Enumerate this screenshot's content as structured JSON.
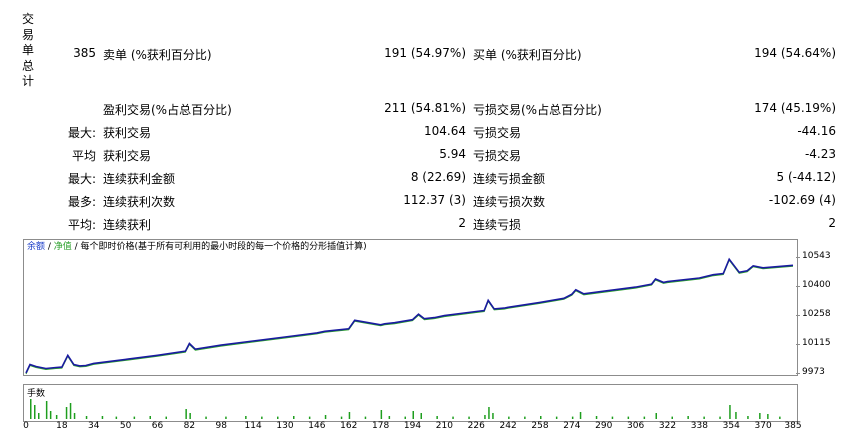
{
  "sidebar": {
    "chars": [
      "交",
      "易",
      "单",
      "总",
      "计"
    ]
  },
  "stats": {
    "total_trades": "385",
    "short_label": "卖单 (%获利百分比)",
    "short_value": "191 (54.97%)",
    "long_label": "买单 (%获利百分比)",
    "long_value": "194 (54.64%)",
    "profit_trades_label": "盈利交易(%占总百分比)",
    "profit_trades_value": "211 (54.81%)",
    "loss_trades_label": "亏损交易(%占总百分比)",
    "loss_trades_value": "174 (45.19%)",
    "rows": [
      {
        "prefix": "最大:",
        "label1": "获利交易",
        "value1": "104.64",
        "label2": "亏损交易",
        "value2": "-44.16"
      },
      {
        "prefix": "平均",
        "label1": "获利交易",
        "value1": "5.94",
        "label2": "亏损交易",
        "value2": "-4.23"
      },
      {
        "prefix": "最大:",
        "label1": "连续获利金额",
        "value1": "8 (22.69)",
        "label2": "连续亏损金额",
        "value2": "5 (-44.12)"
      },
      {
        "prefix": "最多:",
        "label1": "连续获利次数",
        "value1": "112.37 (3)",
        "label2": "连续亏损次数",
        "value2": "-102.69 (4)"
      },
      {
        "prefix": "平均:",
        "label1": "连续获利",
        "value1": "2",
        "label2": "连续亏损",
        "value2": "2"
      }
    ]
  },
  "chart": {
    "legend_balance": "余额",
    "legend_sep": " / ",
    "legend_equity": "净值",
    "legend_desc": " / 每个即时价格(基于所有可利用的最小时段的每一个价格的分形插值计算)",
    "volume_title": "手数",
    "colors": {
      "balance": "#1a1aa0",
      "equity": "#28a028",
      "volume": "#1e9e1e"
    }
  },
  "chart_data": {
    "type": "line",
    "y_ticks": [
      "10543",
      "10400",
      "10258",
      "10115",
      "9973"
    ],
    "x_ticks": [
      "0",
      "18",
      "34",
      "50",
      "66",
      "82",
      "98",
      "114",
      "130",
      "146",
      "162",
      "178",
      "194",
      "210",
      "226",
      "242",
      "258",
      "274",
      "290",
      "306",
      "322",
      "338",
      "354",
      "370",
      "385"
    ],
    "ylim": [
      9973,
      10543
    ],
    "xlim": [
      0,
      385
    ],
    "series": [
      {
        "name": "余额",
        "x": [
          0,
          2,
          5,
          10,
          15,
          18,
          21,
          24,
          27,
          30,
          34,
          50,
          66,
          80,
          82,
          85,
          98,
          114,
          130,
          146,
          150,
          162,
          165,
          178,
          180,
          185,
          194,
          197,
          200,
          205,
          210,
          226,
          230,
          232,
          235,
          240,
          242,
          258,
          270,
          274,
          276,
          280,
          290,
          306,
          314,
          316,
          320,
          322,
          338,
          345,
          350,
          353,
          358,
          362,
          365,
          370,
          385
        ],
        "y": [
          9973,
          10015,
          10005,
          9995,
          10000,
          10002,
          10060,
          10015,
          10008,
          10010,
          10020,
          10040,
          10060,
          10080,
          10118,
          10090,
          10110,
          10130,
          10150,
          10170,
          10178,
          10190,
          10232,
          10210,
          10215,
          10220,
          10235,
          10262,
          10240,
          10245,
          10255,
          10275,
          10280,
          10330,
          10288,
          10292,
          10296,
          10320,
          10340,
          10360,
          10382,
          10362,
          10375,
          10395,
          10410,
          10435,
          10418,
          10422,
          10440,
          10456,
          10462,
          10532,
          10468,
          10475,
          10500,
          10490,
          10502
        ]
      }
    ],
    "volume": [
      {
        "x": 2,
        "v": 1.0
      },
      {
        "x": 4,
        "v": 0.7
      },
      {
        "x": 6,
        "v": 0.3
      },
      {
        "x": 10,
        "v": 0.9
      },
      {
        "x": 12,
        "v": 0.4
      },
      {
        "x": 15,
        "v": 0.2
      },
      {
        "x": 20,
        "v": 0.6
      },
      {
        "x": 22,
        "v": 0.8
      },
      {
        "x": 24,
        "v": 0.3
      },
      {
        "x": 30,
        "v": 0.15
      },
      {
        "x": 38,
        "v": 0.15
      },
      {
        "x": 45,
        "v": 0.12
      },
      {
        "x": 54,
        "v": 0.12
      },
      {
        "x": 62,
        "v": 0.15
      },
      {
        "x": 70,
        "v": 0.12
      },
      {
        "x": 80,
        "v": 0.5
      },
      {
        "x": 82,
        "v": 0.3
      },
      {
        "x": 90,
        "v": 0.12
      },
      {
        "x": 100,
        "v": 0.12
      },
      {
        "x": 110,
        "v": 0.15
      },
      {
        "x": 118,
        "v": 0.12
      },
      {
        "x": 126,
        "v": 0.12
      },
      {
        "x": 134,
        "v": 0.15
      },
      {
        "x": 142,
        "v": 0.12
      },
      {
        "x": 150,
        "v": 0.2
      },
      {
        "x": 158,
        "v": 0.12
      },
      {
        "x": 162,
        "v": 0.35
      },
      {
        "x": 170,
        "v": 0.12
      },
      {
        "x": 178,
        "v": 0.45
      },
      {
        "x": 182,
        "v": 0.15
      },
      {
        "x": 190,
        "v": 0.12
      },
      {
        "x": 194,
        "v": 0.4
      },
      {
        "x": 198,
        "v": 0.3
      },
      {
        "x": 206,
        "v": 0.15
      },
      {
        "x": 214,
        "v": 0.12
      },
      {
        "x": 222,
        "v": 0.12
      },
      {
        "x": 230,
        "v": 0.2
      },
      {
        "x": 232,
        "v": 0.6
      },
      {
        "x": 234,
        "v": 0.3
      },
      {
        "x": 242,
        "v": 0.12
      },
      {
        "x": 250,
        "v": 0.12
      },
      {
        "x": 258,
        "v": 0.15
      },
      {
        "x": 266,
        "v": 0.12
      },
      {
        "x": 274,
        "v": 0.12
      },
      {
        "x": 278,
        "v": 0.35
      },
      {
        "x": 286,
        "v": 0.15
      },
      {
        "x": 294,
        "v": 0.12
      },
      {
        "x": 302,
        "v": 0.12
      },
      {
        "x": 310,
        "v": 0.12
      },
      {
        "x": 316,
        "v": 0.3
      },
      {
        "x": 324,
        "v": 0.12
      },
      {
        "x": 332,
        "v": 0.15
      },
      {
        "x": 340,
        "v": 0.12
      },
      {
        "x": 348,
        "v": 0.12
      },
      {
        "x": 353,
        "v": 0.7
      },
      {
        "x": 356,
        "v": 0.35
      },
      {
        "x": 362,
        "v": 0.15
      },
      {
        "x": 368,
        "v": 0.3
      },
      {
        "x": 372,
        "v": 0.25
      },
      {
        "x": 378,
        "v": 0.12
      }
    ]
  }
}
